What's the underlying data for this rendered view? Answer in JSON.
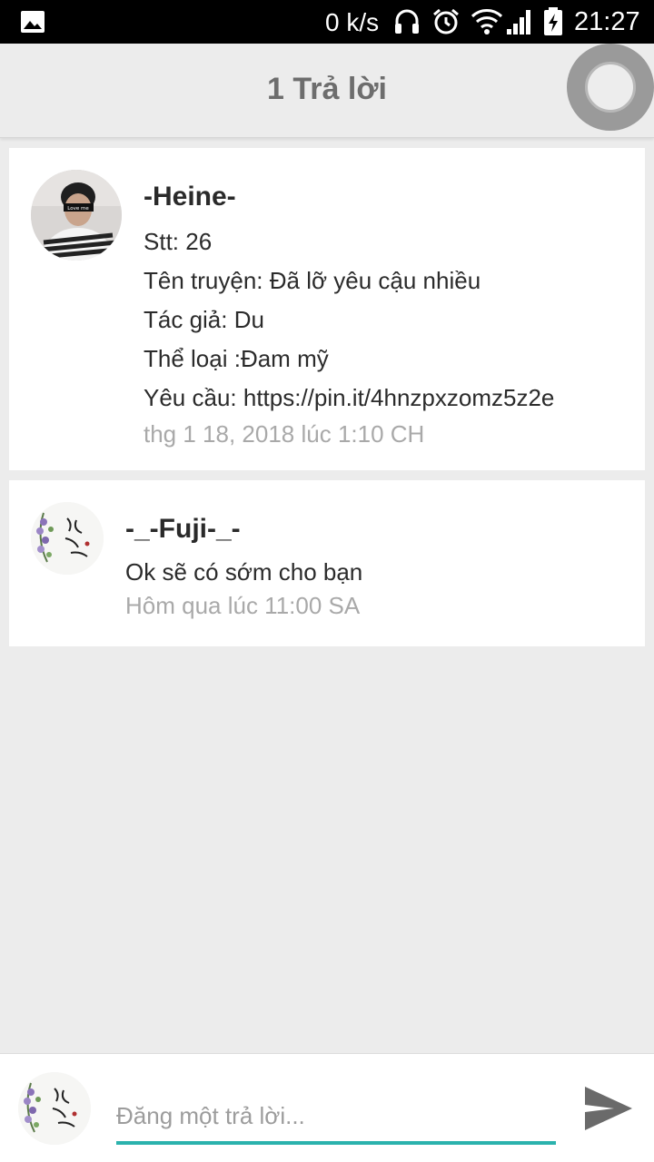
{
  "status_bar": {
    "net_speed": "0 k/s",
    "time": "21:27",
    "icons": [
      "image-icon",
      "headphones-icon",
      "alarm-icon",
      "wifi-icon",
      "signal-icon",
      "battery-charging-icon"
    ]
  },
  "app_bar": {
    "title": "1 Trả lời"
  },
  "posts": [
    {
      "author": "-Heine-",
      "lines": [
        "Stt: 26",
        "Tên truyện: Đã lỡ yêu cậu nhiều",
        "Tác giả: Du",
        "Thể loại :Đam mỹ",
        "Yêu cầu: https://pin.it/4hnzpxzomz5z2e"
      ],
      "timestamp": "thg 1 18, 2018 lúc 1:10 CH",
      "avatar_text": "Love me"
    },
    {
      "author": "-_-Fuji-_-",
      "lines": [
        "Ok sẽ có sớm cho bạn"
      ],
      "timestamp": "Hôm qua lúc 11:00 SA"
    }
  ],
  "reply": {
    "placeholder": "Đăng một trả lời...",
    "value": ""
  },
  "colors": {
    "accent": "#2bb2ad",
    "background": "#ececec",
    "timestamp": "#a9a9a9"
  }
}
